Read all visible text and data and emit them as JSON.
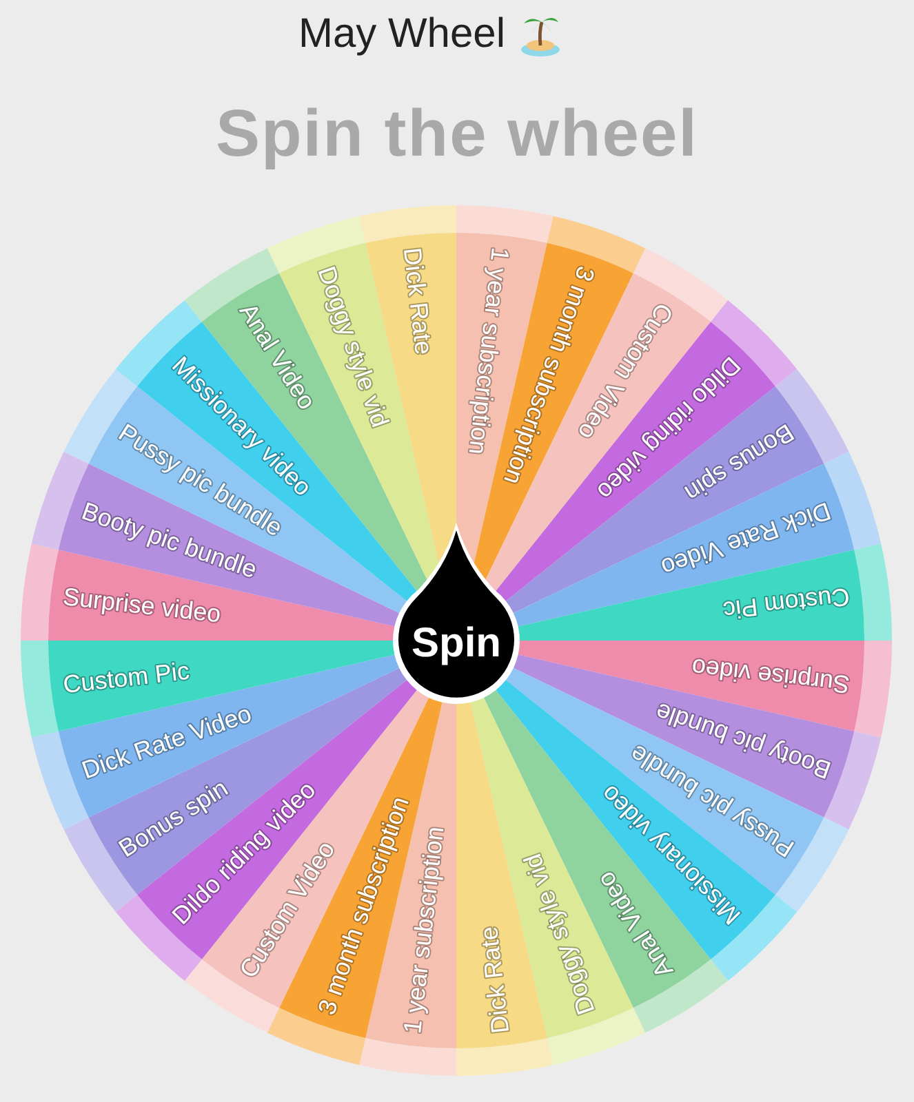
{
  "title": "May Wheel",
  "heading": "Spin the wheel",
  "wheel": {
    "button": "Spin",
    "segments": [
      {
        "label": "1 year subscription",
        "color": "#f6c0b0"
      },
      {
        "label": "3 month subscription",
        "color": "#f8a434"
      },
      {
        "label": "Custom Video",
        "color": "#f5c2bd"
      },
      {
        "label": "Dildo riding video",
        "color": "#c46ae0"
      },
      {
        "label": "Bonus spin",
        "color": "#9d96e0"
      },
      {
        "label": "Dick Rate Video",
        "color": "#7fb6ef"
      },
      {
        "label": "Custom Pic",
        "color": "#3ed8c3"
      },
      {
        "label": "Surprise video",
        "color": "#ef8bab"
      },
      {
        "label": "Booty pic bundle",
        "color": "#b48fe0"
      },
      {
        "label": "Pussy pic bundle",
        "color": "#90c6f3"
      },
      {
        "label": "Missionary video",
        "color": "#40d0ee"
      },
      {
        "label": "Anal Video",
        "color": "#8fd49f"
      },
      {
        "label": "Doggy style vid",
        "color": "#dce996"
      },
      {
        "label": "Dick Rate",
        "color": "#f6da86"
      },
      {
        "label": "1 year subscription",
        "color": "#f6c0b0"
      },
      {
        "label": "3 month subscription",
        "color": "#f8a434"
      },
      {
        "label": "Custom Video",
        "color": "#f5c2bd"
      },
      {
        "label": "Dildo riding video",
        "color": "#c46ae0"
      },
      {
        "label": "Bonus spin",
        "color": "#9d96e0"
      },
      {
        "label": "Dick Rate Video",
        "color": "#7fb6ef"
      },
      {
        "label": "Custom Pic",
        "color": "#3ed8c3"
      },
      {
        "label": "Surprise video",
        "color": "#ef8bab"
      },
      {
        "label": "Booty pic bundle",
        "color": "#b48fe0"
      },
      {
        "label": "Pussy pic bundle",
        "color": "#90c6f3"
      },
      {
        "label": "Missionary video",
        "color": "#40d0ee"
      },
      {
        "label": "Anal Video",
        "color": "#8fd49f"
      },
      {
        "label": "Doggy style vid",
        "color": "#dce996"
      },
      {
        "label": "Dick Rate",
        "color": "#f6da86"
      }
    ]
  }
}
